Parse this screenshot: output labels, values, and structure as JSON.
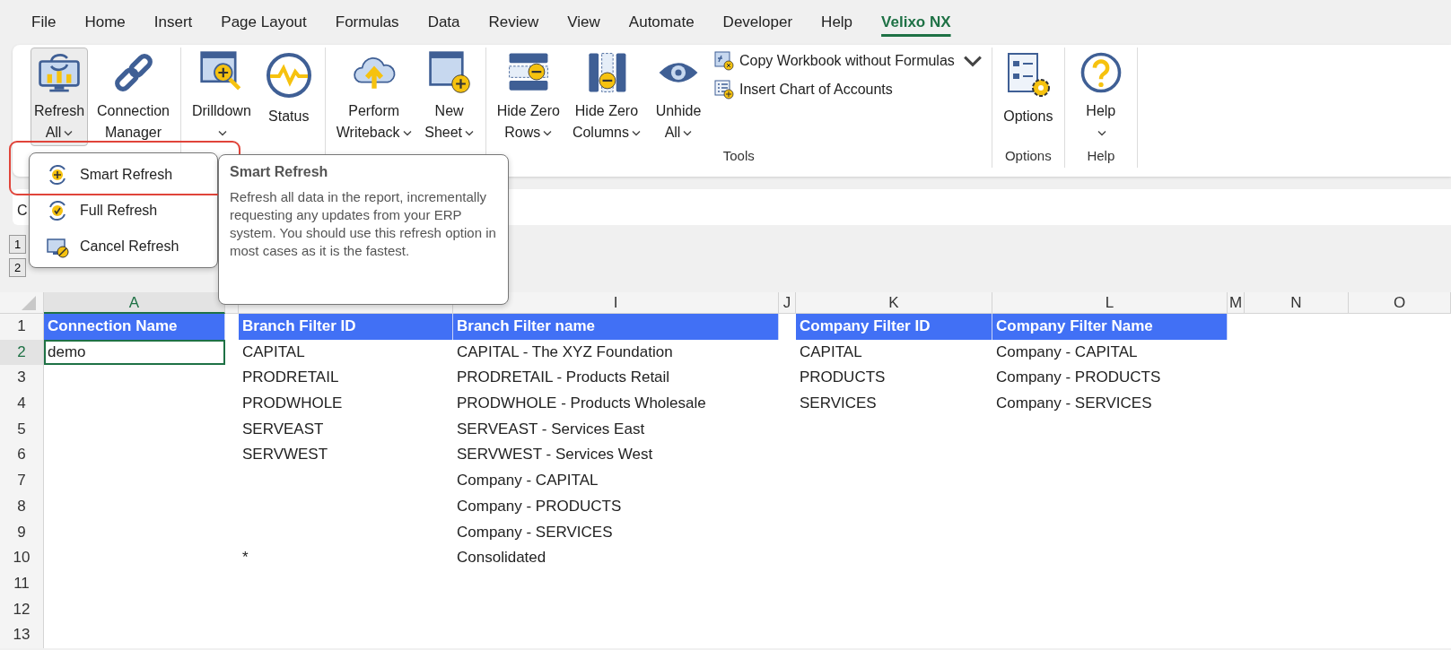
{
  "tabs": [
    {
      "label": "File",
      "selected": false
    },
    {
      "label": "Home",
      "selected": false
    },
    {
      "label": "Insert",
      "selected": false
    },
    {
      "label": "Page Layout",
      "selected": false
    },
    {
      "label": "Formulas",
      "selected": false
    },
    {
      "label": "Data",
      "selected": false
    },
    {
      "label": "Review",
      "selected": false
    },
    {
      "label": "View",
      "selected": false
    },
    {
      "label": "Automate",
      "selected": false
    },
    {
      "label": "Developer",
      "selected": false
    },
    {
      "label": "Help",
      "selected": false
    },
    {
      "label": "Velixo NX",
      "selected": true
    }
  ],
  "ribbon": {
    "groups": [
      {
        "buttons": [
          {
            "lines": [
              "Refresh",
              "All"
            ],
            "dropdown": true,
            "pressed": true
          },
          {
            "lines": [
              "Connection",
              "Manager"
            ],
            "dropdown": false,
            "pressed": false
          }
        ]
      },
      {
        "buttons": [
          {
            "lines": [
              "Drilldown"
            ],
            "dropdown": true,
            "pressed": false
          },
          {
            "lines": [
              "Status"
            ],
            "dropdown": false,
            "pressed": false
          }
        ]
      },
      {
        "buttons": [
          {
            "lines": [
              "Perform",
              "Writeback"
            ],
            "dropdown": true,
            "pressed": false
          },
          {
            "lines": [
              "New",
              "Sheet"
            ],
            "dropdown": true,
            "pressed": false
          }
        ]
      },
      {
        "label": "Tools",
        "buttons": [
          {
            "lines": [
              "Hide Zero",
              "Rows"
            ],
            "dropdown": true,
            "pressed": false
          },
          {
            "lines": [
              "Hide Zero",
              "Columns"
            ],
            "dropdown": true,
            "pressed": false
          },
          {
            "lines": [
              "Unhide",
              "All"
            ],
            "dropdown": true,
            "pressed": false
          }
        ],
        "small_buttons": [
          {
            "label": "Copy Workbook without Formulas",
            "dropdown": true
          },
          {
            "label": "Insert Chart of Accounts",
            "dropdown": false
          }
        ]
      },
      {
        "label": "Options",
        "buttons": [
          {
            "lines": [
              "Options"
            ],
            "dropdown": false,
            "pressed": false
          }
        ]
      },
      {
        "label": "Help",
        "buttons": [
          {
            "lines": [
              "Help"
            ],
            "dropdown": true,
            "pressed": false
          }
        ]
      }
    ]
  },
  "formula_bar": {
    "name_box": "C"
  },
  "outline_levels": [
    "1",
    "2"
  ],
  "dropdown_menu": {
    "items": [
      {
        "label": "Smart Refresh",
        "highlighted": true
      },
      {
        "label": "Full Refresh",
        "highlighted": false
      },
      {
        "label": "Cancel Refresh",
        "highlighted": false
      }
    ]
  },
  "tooltip": {
    "title": "Smart Refresh",
    "text": "Refresh all data in the report, incrementally requesting any updates from your ERP system. You should use this refresh option in most cases as it is the fastest."
  },
  "sheet": {
    "columns": [
      "A",
      "I",
      "J",
      "K",
      "L",
      "M",
      "N",
      "O"
    ],
    "rows": [
      {
        "number": "1",
        "kind": "header",
        "selected": false,
        "cells": {
          "A": "Connection Name",
          "H": "Branch Filter ID",
          "I": "Branch Filter name",
          "K": "Company Filter ID",
          "L": "Company Filter Name"
        }
      },
      {
        "number": "2",
        "kind": "data",
        "selected": true,
        "cells": {
          "A": "demo",
          "H": "CAPITAL",
          "I": "CAPITAL - The XYZ Foundation",
          "K": "CAPITAL",
          "L": "Company - CAPITAL"
        }
      },
      {
        "number": "3",
        "kind": "data",
        "selected": false,
        "cells": {
          "H": "PRODRETAIL",
          "I": "PRODRETAIL - Products Retail",
          "K": "PRODUCTS",
          "L": "Company - PRODUCTS"
        }
      },
      {
        "number": "4",
        "kind": "data",
        "selected": false,
        "cells": {
          "H": "PRODWHOLE",
          "I": "PRODWHOLE - Products Wholesale",
          "K": "SERVICES",
          "L": "Company - SERVICES"
        }
      },
      {
        "number": "5",
        "kind": "data",
        "selected": false,
        "cells": {
          "H": "SERVEAST",
          "I": "SERVEAST - Services East"
        }
      },
      {
        "number": "6",
        "kind": "data",
        "selected": false,
        "cells": {
          "H": "SERVWEST",
          "I": "SERVWEST - Services West"
        }
      },
      {
        "number": "7",
        "kind": "data",
        "selected": false,
        "cells": {
          "I": "Company - CAPITAL"
        }
      },
      {
        "number": "8",
        "kind": "data",
        "selected": false,
        "cells": {
          "I": "Company - PRODUCTS"
        }
      },
      {
        "number": "9",
        "kind": "data",
        "selected": false,
        "cells": {
          "I": "Company - SERVICES"
        }
      },
      {
        "number": "10",
        "kind": "data",
        "selected": false,
        "cells": {
          "H": "*",
          "I": "Consolidated"
        }
      },
      {
        "number": "11",
        "kind": "data",
        "selected": false,
        "cells": {}
      },
      {
        "number": "12",
        "kind": "data",
        "selected": false,
        "cells": {}
      },
      {
        "number": "13",
        "kind": "data",
        "selected": false,
        "cells": {}
      }
    ]
  }
}
